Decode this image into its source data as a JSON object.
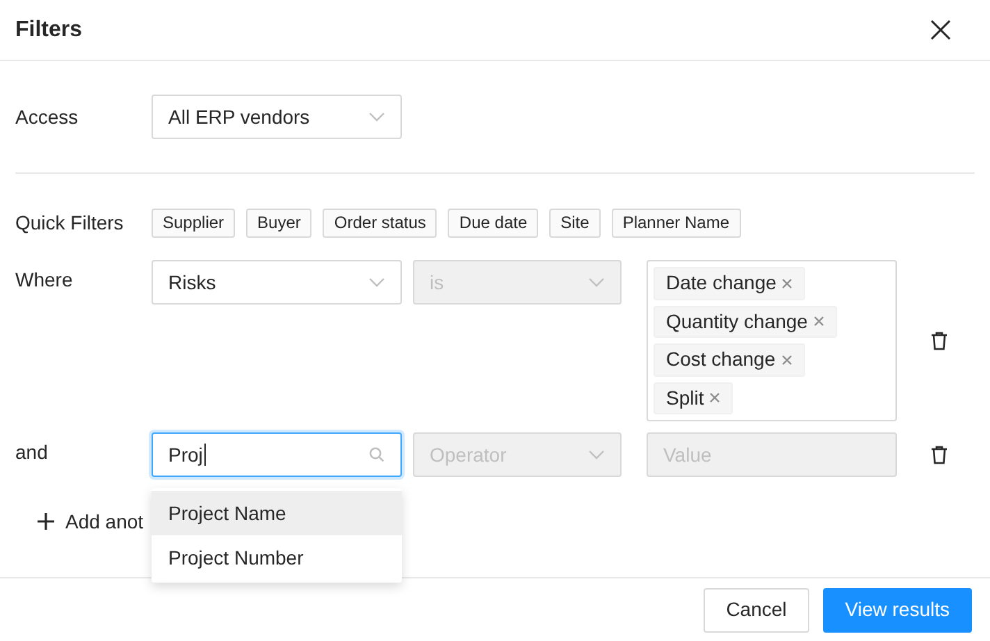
{
  "dialog": {
    "title": "Filters"
  },
  "access": {
    "label": "Access",
    "value": "All ERP vendors"
  },
  "quick_filters": {
    "label": "Quick Filters",
    "chips": [
      "Supplier",
      "Buyer",
      "Order status",
      "Due date",
      "Site",
      "Planner Name"
    ]
  },
  "conditions": [
    {
      "connector": "Where",
      "field": {
        "value": "Risks",
        "focused": false
      },
      "operator": {
        "value": "is",
        "disabled": true
      },
      "values": {
        "kind": "tags",
        "tags": [
          "Date change",
          "Quantity change",
          "Cost change",
          "Split"
        ]
      }
    },
    {
      "connector": "and",
      "field": {
        "value": "Proj",
        "focused": true
      },
      "operator": {
        "placeholder": "Operator",
        "disabled": true
      },
      "values": {
        "kind": "input",
        "placeholder": "Value",
        "disabled": true
      }
    }
  ],
  "field_suggestions": {
    "items": [
      {
        "label": "Project Name",
        "selected": true
      },
      {
        "label": "Project Number",
        "selected": false
      }
    ]
  },
  "add_condition": {
    "label": "Add anot"
  },
  "buttons": [
    {
      "label": "Cancel",
      "kind": "secondary"
    },
    {
      "label": "View results",
      "kind": "primary"
    }
  ]
}
